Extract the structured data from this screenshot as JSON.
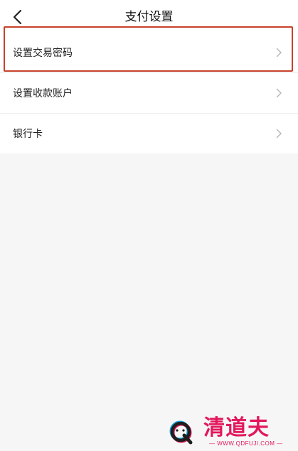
{
  "nav": {
    "back_icon": "chevron-left-icon",
    "title": "支付设置"
  },
  "settings": {
    "items": [
      {
        "label": "设置交易密码",
        "icon": "chevron-right-icon",
        "highlighted": true
      },
      {
        "label": "设置收款账户",
        "icon": "chevron-right-icon",
        "highlighted": false
      },
      {
        "label": "银行卡",
        "icon": "chevron-right-icon",
        "highlighted": false
      }
    ]
  },
  "watermark": {
    "brand": "清道夫",
    "url": "— WWW.QDFUJI.COM —",
    "icon": "q-logo-icon"
  },
  "colors": {
    "highlight": "#c8402c",
    "watermark": "#e2185a",
    "background": "#f6f6f6"
  }
}
